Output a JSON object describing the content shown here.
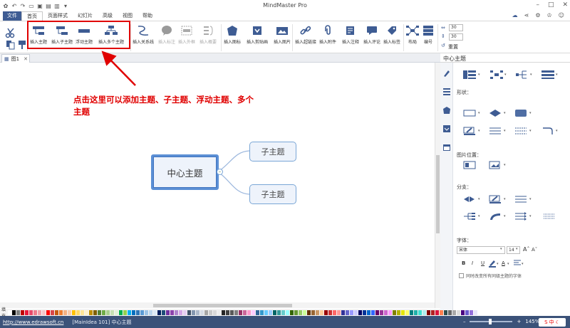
{
  "app": {
    "title": "MindMaster Pro"
  },
  "tabs": [
    {
      "label": "文件"
    },
    {
      "label": "首页"
    },
    {
      "label": "页面样式"
    },
    {
      "label": "幻灯片"
    },
    {
      "label": "高级"
    },
    {
      "label": "视图"
    },
    {
      "label": "帮助"
    }
  ],
  "ribbon": {
    "insert_topic": "插入主题",
    "insert_subtopic": "插入子主题",
    "floating_topic": "浮动主题",
    "multiple_topics": "插入多个主题",
    "relationship": "插入关系线",
    "callout": "插入标注",
    "boundary": "插入外框",
    "summary": "插入概要",
    "icon": "插入图标",
    "clipart": "插入剪贴画",
    "picture": "插入图片",
    "hyperlink": "插入超链接",
    "attachment": "插入附件",
    "note": "插入注释",
    "comment": "插入评论",
    "tag": "插入标签",
    "layout": "布局",
    "numbering": "编号",
    "spin_top": "30",
    "spin_bottom": "30",
    "reset": "重置"
  },
  "document": {
    "tab_name": "图1"
  },
  "annotation": "点击这里可以添加主题、子主题、浮动主题、多个主题",
  "mindmap": {
    "central": "中心主题",
    "subtopics": [
      "子主题",
      "子主题"
    ]
  },
  "panel": {
    "title": "中心主题",
    "shape_label": "形状：",
    "image_position_label": "图片位置：",
    "branch_label": "分支：",
    "font_label": "字体：",
    "font_name": "宋体",
    "font_size": "14",
    "bold": "B",
    "italic": "I",
    "underline": "U",
    "color_a": "A",
    "checkbox_label": "同时改变所有同级主题的字体"
  },
  "palette": {
    "label": "填充",
    "colors": [
      "#ffffff",
      "#000000",
      "#7f7f7f",
      "#c00000",
      "#e8173a",
      "#e84a6a",
      "#ee7b8c",
      "#f2a0a9",
      "#f6c4c9",
      "#ff0000",
      "#d9474a",
      "#c55a11",
      "#ed7d31",
      "#f4b183",
      "#f8cbad",
      "#ffc000",
      "#ffd966",
      "#ffe699",
      "#fff2cc",
      "#bf9000",
      "#7f6000",
      "#548235",
      "#70ad47",
      "#a9d18e",
      "#c5e0b4",
      "#e2f0d9",
      "#00b050",
      "#92d050",
      "#00b0f0",
      "#0070c0",
      "#2e75b6",
      "#5b9bd5",
      "#9dc3e6",
      "#bdd7ee",
      "#deebf7",
      "#002060",
      "#1f4e79",
      "#7030a0",
      "#8e44ad",
      "#b084cc",
      "#d5a6e6",
      "#e6cff2",
      "#44546a",
      "#8497b0",
      "#adb9ca",
      "#d6dce5",
      "#a5a5a5",
      "#c9c9c9",
      "#d9d9d9",
      "#ededed",
      "#262626",
      "#404040",
      "#595959",
      "#808080",
      "#993366",
      "#cc6699",
      "#ff99cc",
      "#ffccff",
      "#336699",
      "#3399cc",
      "#66ccff",
      "#99ccff",
      "#006666",
      "#339999",
      "#66cccc",
      "#99ffff",
      "#336600",
      "#669933",
      "#99cc66",
      "#ccff99",
      "#663300",
      "#996633",
      "#cc9966",
      "#ffcc99",
      "#990000",
      "#cc3333",
      "#ff6666",
      "#ff9999",
      "#333399",
      "#6666cc",
      "#9999ff",
      "#ccccff",
      "#000066",
      "#003399",
      "#0066cc",
      "#3366ff",
      "#660066",
      "#993399",
      "#cc66cc",
      "#ff99ff",
      "#808000",
      "#b3b300",
      "#e6e600",
      "#ffff66",
      "#008080",
      "#20b2aa",
      "#40e0d0",
      "#afeeee",
      "#800000",
      "#b22222",
      "#dc143c",
      "#ff7f50",
      "#2f4f4f",
      "#696969",
      "#a9a9a9",
      "#dcdcdc",
      "#4b0082",
      "#6a5acd",
      "#9370db",
      "#e6e6fa"
    ]
  },
  "status": {
    "url": "http://www.edrawsoft.cn",
    "main_idea": "[MainIdea 101]  中心主题",
    "zoom": "145%"
  },
  "colors": {
    "accent": "#3e5c93",
    "highlight": "#e00000",
    "topic_border": "#5b8fd5"
  }
}
